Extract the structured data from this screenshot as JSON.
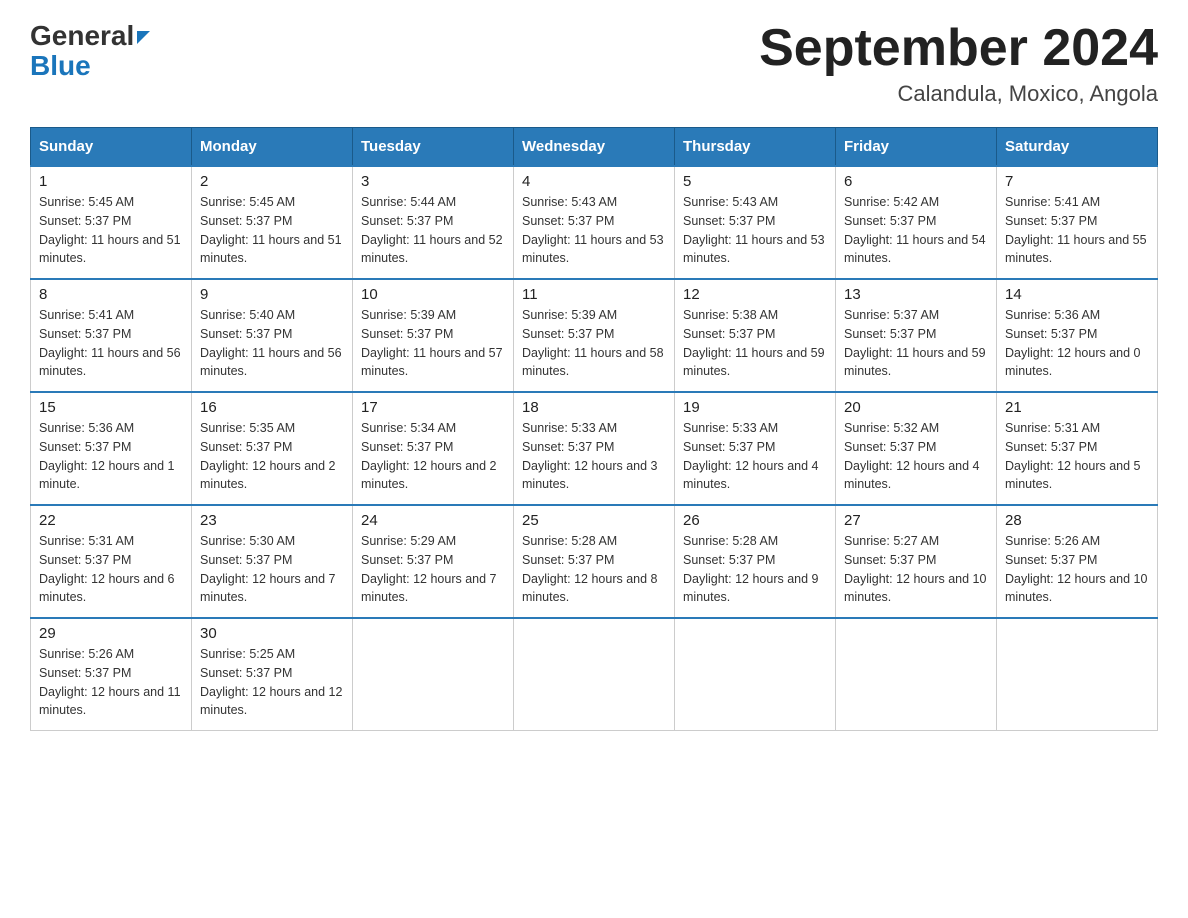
{
  "header": {
    "logo_general": "General",
    "logo_blue": "Blue",
    "month_title": "September 2024",
    "location": "Calandula, Moxico, Angola"
  },
  "calendar": {
    "days_of_week": [
      "Sunday",
      "Monday",
      "Tuesday",
      "Wednesday",
      "Thursday",
      "Friday",
      "Saturday"
    ],
    "weeks": [
      [
        {
          "day": "1",
          "sunrise": "5:45 AM",
          "sunset": "5:37 PM",
          "daylight": "11 hours and 51 minutes."
        },
        {
          "day": "2",
          "sunrise": "5:45 AM",
          "sunset": "5:37 PM",
          "daylight": "11 hours and 51 minutes."
        },
        {
          "day": "3",
          "sunrise": "5:44 AM",
          "sunset": "5:37 PM",
          "daylight": "11 hours and 52 minutes."
        },
        {
          "day": "4",
          "sunrise": "5:43 AM",
          "sunset": "5:37 PM",
          "daylight": "11 hours and 53 minutes."
        },
        {
          "day": "5",
          "sunrise": "5:43 AM",
          "sunset": "5:37 PM",
          "daylight": "11 hours and 53 minutes."
        },
        {
          "day": "6",
          "sunrise": "5:42 AM",
          "sunset": "5:37 PM",
          "daylight": "11 hours and 54 minutes."
        },
        {
          "day": "7",
          "sunrise": "5:41 AM",
          "sunset": "5:37 PM",
          "daylight": "11 hours and 55 minutes."
        }
      ],
      [
        {
          "day": "8",
          "sunrise": "5:41 AM",
          "sunset": "5:37 PM",
          "daylight": "11 hours and 56 minutes."
        },
        {
          "day": "9",
          "sunrise": "5:40 AM",
          "sunset": "5:37 PM",
          "daylight": "11 hours and 56 minutes."
        },
        {
          "day": "10",
          "sunrise": "5:39 AM",
          "sunset": "5:37 PM",
          "daylight": "11 hours and 57 minutes."
        },
        {
          "day": "11",
          "sunrise": "5:39 AM",
          "sunset": "5:37 PM",
          "daylight": "11 hours and 58 minutes."
        },
        {
          "day": "12",
          "sunrise": "5:38 AM",
          "sunset": "5:37 PM",
          "daylight": "11 hours and 59 minutes."
        },
        {
          "day": "13",
          "sunrise": "5:37 AM",
          "sunset": "5:37 PM",
          "daylight": "11 hours and 59 minutes."
        },
        {
          "day": "14",
          "sunrise": "5:36 AM",
          "sunset": "5:37 PM",
          "daylight": "12 hours and 0 minutes."
        }
      ],
      [
        {
          "day": "15",
          "sunrise": "5:36 AM",
          "sunset": "5:37 PM",
          "daylight": "12 hours and 1 minute."
        },
        {
          "day": "16",
          "sunrise": "5:35 AM",
          "sunset": "5:37 PM",
          "daylight": "12 hours and 2 minutes."
        },
        {
          "day": "17",
          "sunrise": "5:34 AM",
          "sunset": "5:37 PM",
          "daylight": "12 hours and 2 minutes."
        },
        {
          "day": "18",
          "sunrise": "5:33 AM",
          "sunset": "5:37 PM",
          "daylight": "12 hours and 3 minutes."
        },
        {
          "day": "19",
          "sunrise": "5:33 AM",
          "sunset": "5:37 PM",
          "daylight": "12 hours and 4 minutes."
        },
        {
          "day": "20",
          "sunrise": "5:32 AM",
          "sunset": "5:37 PM",
          "daylight": "12 hours and 4 minutes."
        },
        {
          "day": "21",
          "sunrise": "5:31 AM",
          "sunset": "5:37 PM",
          "daylight": "12 hours and 5 minutes."
        }
      ],
      [
        {
          "day": "22",
          "sunrise": "5:31 AM",
          "sunset": "5:37 PM",
          "daylight": "12 hours and 6 minutes."
        },
        {
          "day": "23",
          "sunrise": "5:30 AM",
          "sunset": "5:37 PM",
          "daylight": "12 hours and 7 minutes."
        },
        {
          "day": "24",
          "sunrise": "5:29 AM",
          "sunset": "5:37 PM",
          "daylight": "12 hours and 7 minutes."
        },
        {
          "day": "25",
          "sunrise": "5:28 AM",
          "sunset": "5:37 PM",
          "daylight": "12 hours and 8 minutes."
        },
        {
          "day": "26",
          "sunrise": "5:28 AM",
          "sunset": "5:37 PM",
          "daylight": "12 hours and 9 minutes."
        },
        {
          "day": "27",
          "sunrise": "5:27 AM",
          "sunset": "5:37 PM",
          "daylight": "12 hours and 10 minutes."
        },
        {
          "day": "28",
          "sunrise": "5:26 AM",
          "sunset": "5:37 PM",
          "daylight": "12 hours and 10 minutes."
        }
      ],
      [
        {
          "day": "29",
          "sunrise": "5:26 AM",
          "sunset": "5:37 PM",
          "daylight": "12 hours and 11 minutes."
        },
        {
          "day": "30",
          "sunrise": "5:25 AM",
          "sunset": "5:37 PM",
          "daylight": "12 hours and 12 minutes."
        },
        null,
        null,
        null,
        null,
        null
      ]
    ]
  }
}
